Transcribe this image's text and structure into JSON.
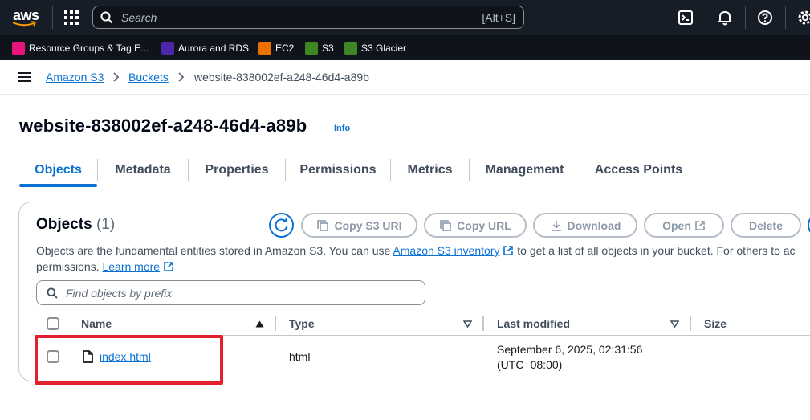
{
  "topnav": {
    "logo_text": "aws",
    "search_placeholder": "Search",
    "search_shortcut": "[Alt+S]",
    "icons": [
      "grid-icon",
      "search-icon",
      "cloudshell-icon",
      "bell-icon",
      "help-icon",
      "gear-icon"
    ]
  },
  "favorites": [
    {
      "label": "Resource Groups & Tag E...",
      "color": "#e7157b"
    },
    {
      "label": "Aurora and RDS",
      "color": "#4d27aa"
    },
    {
      "label": "EC2",
      "color": "#ed7100"
    },
    {
      "label": "S3",
      "color": "#3f8624"
    },
    {
      "label": "S3 Glacier",
      "color": "#3f8624"
    }
  ],
  "breadcrumb": {
    "items": [
      "Amazon S3",
      "Buckets"
    ],
    "current": "website-838002ef-a248-46d4-a89b"
  },
  "page": {
    "title": "website-838002ef-a248-46d4-a89b",
    "info": "Info"
  },
  "tabs": [
    {
      "label": "Objects",
      "active": true
    },
    {
      "label": "Metadata"
    },
    {
      "label": "Properties"
    },
    {
      "label": "Permissions"
    },
    {
      "label": "Metrics"
    },
    {
      "label": "Management"
    },
    {
      "label": "Access Points"
    }
  ],
  "objects_panel": {
    "title": "Objects",
    "count": "(1)",
    "buttons": {
      "copy_uri": "Copy S3 URI",
      "copy_url": "Copy URL",
      "download": "Download",
      "open": "Open",
      "delete": "Delete"
    },
    "description_part1": "Objects are the fundamental entities stored in Amazon S3. You can use",
    "inventory_link": "Amazon S3 inventory",
    "description_part2": "to get a list of all objects in your bucket. For others to ac",
    "description_part3": "permissions.",
    "learn_more": "Learn more",
    "filter_placeholder": "Find objects by prefix",
    "columns": [
      "Name",
      "Type",
      "Last modified",
      "Size"
    ],
    "rows": [
      {
        "name": "index.html",
        "type": "html",
        "last_modified_line1": "September 6, 2025, 02:31:56",
        "last_modified_line2": "(UTC+08:00)"
      }
    ]
  },
  "colors": {
    "accent": "#0972d3",
    "nav_bg": "#161d26",
    "highlight": "#e5202e"
  }
}
